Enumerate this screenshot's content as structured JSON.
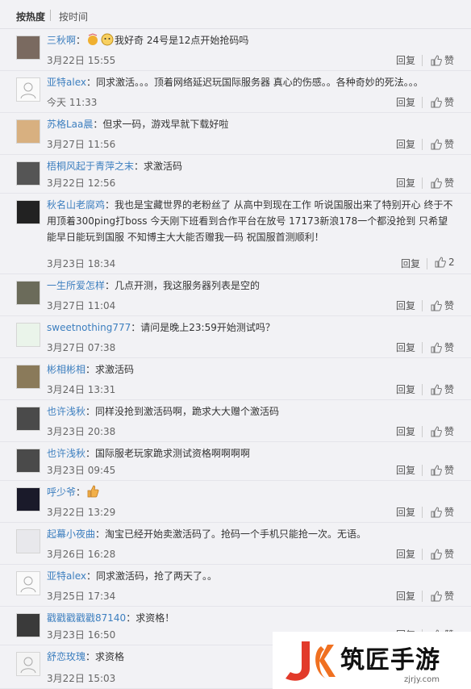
{
  "sort": {
    "hot": "按热度",
    "time": "按时间"
  },
  "actions": {
    "reply": "回复",
    "like": "赞"
  },
  "comments": [
    {
      "user": "三秋啊",
      "text": "我好奇 24号是12点开始抢码吗",
      "time": "3月22日 15:55",
      "avatar": "avatar-photo-icon"
    },
    {
      "user": "亚特alex",
      "text": "同求激活。。。顶着网络延迟玩国际服务器 真心的伤感。。各种奇妙的死法。。。",
      "time": "今天 11:33",
      "avatar": "default-avatar-icon"
    },
    {
      "user": "苏格Laa晨",
      "text": "但求一码，游戏早就下载好啦",
      "time": "3月27日 11:56",
      "avatar": "anime-avatar-icon"
    },
    {
      "user": "梧桐风起于青萍之末",
      "text": "求激活码",
      "time": "3月22日 12:56",
      "avatar": "photo-avatar-icon"
    },
    {
      "user": "秋名山老腐鸡",
      "text": "我也是宝藏世界的老粉丝了 从高中到现在工作 听说国服出来了特别开心 终于不用顶着300ping打boss 今天刚下班看到合作平台在放号 17173新浪178一个都没抢到 只希望能早日能玩到国服 不知博主大大能否赠我一码 祝国服首测顺利！",
      "time": "3月23日 18:34",
      "like_count": "2",
      "avatar": "dark-avatar-icon"
    },
    {
      "user": "一生所爱怎样",
      "text": "几点开测，我这服务器列表是空的",
      "time": "3月27日 11:04",
      "avatar": "photo-avatar-icon"
    },
    {
      "user": "sweetnothing777",
      "text": "请问是晚上23:59开始测试吗？",
      "time": "3月27日 07:38",
      "avatar": "cartoon-avatar-icon"
    },
    {
      "user": "彬相彬相",
      "text": "求激活码",
      "time": "3月24日 13:31",
      "avatar": "photo-avatar-icon"
    },
    {
      "user": "也许浅秋",
      "text": "同样没抢到激活码啊，跪求大大赠个激活码",
      "time": "3月23日 20:38",
      "avatar": "game-avatar-icon"
    },
    {
      "user": "也许浅秋",
      "text": "国际服老玩家跪求测试资格啊啊啊啊",
      "time": "3月23日 09:45",
      "avatar": "game-avatar-icon"
    },
    {
      "user": "呼少爷",
      "text": "",
      "time": "3月22日 13:29",
      "avatar": "wolf-avatar-icon"
    },
    {
      "user": "起幕小夜曲",
      "text": "淘宝已经开始卖激活码了。抢码一个手机只能抢一次。无语。",
      "time": "3月26日 16:28",
      "avatar": "anime-avatar-icon"
    },
    {
      "user": "亚特alex",
      "text": "同求激活码，抢了两天了。。",
      "time": "3月25日 17:34",
      "avatar": "default-avatar-icon"
    },
    {
      "user": "戳戳戳戳戳87140",
      "text": "求资格！",
      "time": "3月23日 16:50",
      "avatar": "photo-avatar-icon"
    },
    {
      "user": "舒恋玫瑰",
      "text": "求资格",
      "time": "3月22日 15:03",
      "avatar": "default-avatar-icon"
    }
  ],
  "watermark": {
    "title": "筑匠手游",
    "url": "zjrjy.com"
  },
  "colors": {
    "username": "#3d7fbf",
    "background": "#f2f2f5",
    "logo_orange": "#f07020",
    "logo_red": "#e23a2a"
  }
}
